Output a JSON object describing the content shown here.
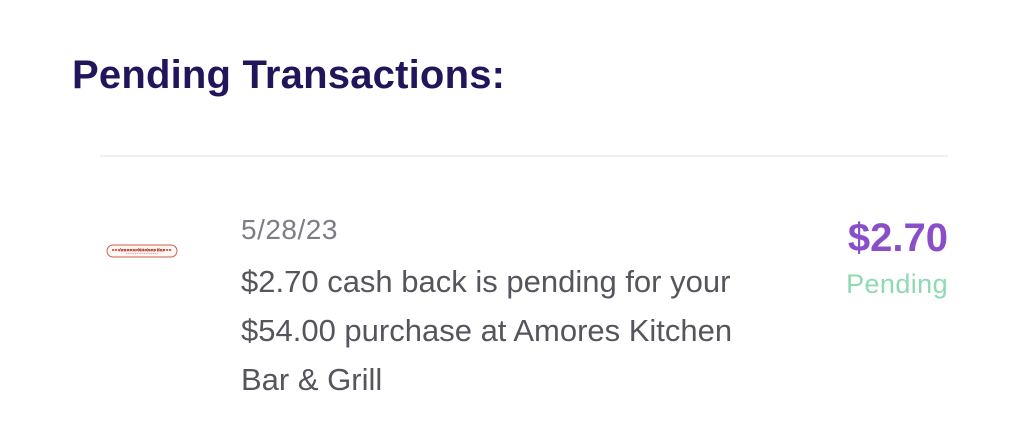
{
  "header": {
    "title": "Pending Transactions:"
  },
  "transactions": [
    {
      "merchant_logo": "Amores Kitchen Bar",
      "date": "5/28/23",
      "description": "$2.70 cash back is pending for your $54.00 purchase at Amores Kitchen Bar & Grill",
      "amount": "$2.70",
      "status": "Pending"
    }
  ],
  "colors": {
    "title": "#23155b",
    "amount": "#8a4fc8",
    "status_pending": "#8fd9b3",
    "body_text": "#55555d",
    "date_text": "#7d7d86",
    "divider": "#f0eff2"
  }
}
